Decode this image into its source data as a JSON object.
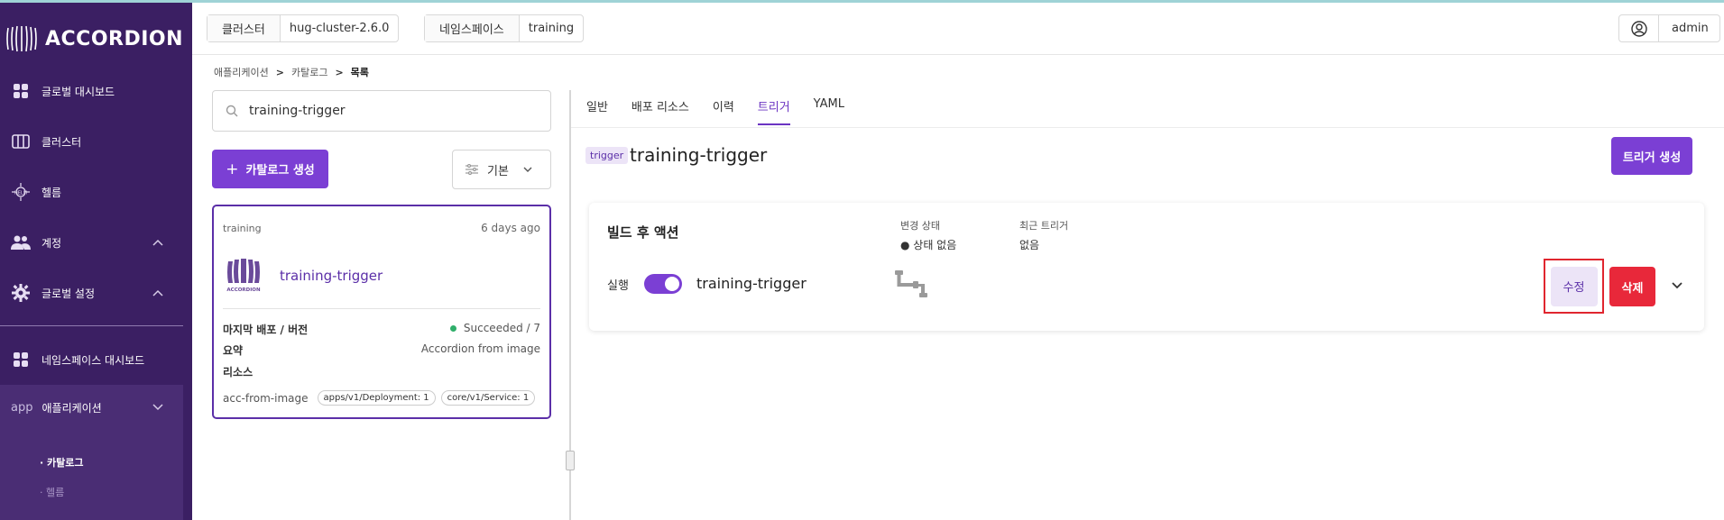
{
  "app": {
    "brand": "ACCORDION"
  },
  "sidebar": {
    "items": [
      {
        "label": "글로벌 대시보드",
        "icon": "grid-icon"
      },
      {
        "label": "클러스터",
        "icon": "columns-icon"
      },
      {
        "label": "헬름",
        "icon": "helm-icon"
      },
      {
        "label": "계정",
        "icon": "users-icon",
        "chevron": "^"
      },
      {
        "label": "글로벌 설정",
        "icon": "gear-icon",
        "chevron": "^"
      },
      {
        "label": "네임스페이스 대시보드",
        "icon": "grid-icon"
      },
      {
        "label": "애플리케이션",
        "prefix": "app",
        "chevron": "v"
      }
    ],
    "sub_items": [
      {
        "label": "· 카탈로그",
        "active": true
      },
      {
        "label": "· 헬름",
        "active": false
      }
    ]
  },
  "header": {
    "cluster_label": "클러스터",
    "cluster_value": "hug-cluster-2.6.0",
    "namespace_label": "네임스페이스",
    "namespace_value": "training",
    "user": "admin"
  },
  "breadcrumb": {
    "items": [
      "애플리케이션",
      "카탈로그",
      "목록"
    ],
    "separator": ">"
  },
  "catalog": {
    "search_value": "training-trigger",
    "create_button": "카탈로그 생성",
    "sort_label": "기본",
    "card": {
      "namespace": "training",
      "age": "6 days ago",
      "title": "training-trigger",
      "last_deploy_label": "마지막 배포 / 버전",
      "last_deploy_value": "Succeeded / 7",
      "summary_label": "요약",
      "summary_value": "Accordion from image",
      "resources_label": "리소스",
      "resource_name": "acc-from-image",
      "resource_tags": [
        "apps/v1/Deployment: 1",
        "core/v1/Service: 1"
      ]
    }
  },
  "detail": {
    "tabs": [
      "일반",
      "배포 리소스",
      "이력",
      "트리거",
      "YAML"
    ],
    "active_tab": "트리거",
    "tag": "trigger",
    "title": "training-trigger",
    "create_trigger_button": "트리거 생성",
    "panel": {
      "title": "빌드 후 액션",
      "run_label": "실행",
      "toggle_on": true,
      "trigger_name": "training-trigger",
      "change_status_label": "변경 상태",
      "change_status_value": "● 상태 없음",
      "recent_trigger_label": "최근 트리거",
      "recent_trigger_value": "없음",
      "edit_button": "수정",
      "delete_button": "삭제"
    }
  },
  "colors": {
    "sidebar_bg": "#3b1f63",
    "accent": "#7b3fd4",
    "danger": "#e8283a",
    "highlight_border": "#e0262f",
    "success": "#2fae6a"
  }
}
